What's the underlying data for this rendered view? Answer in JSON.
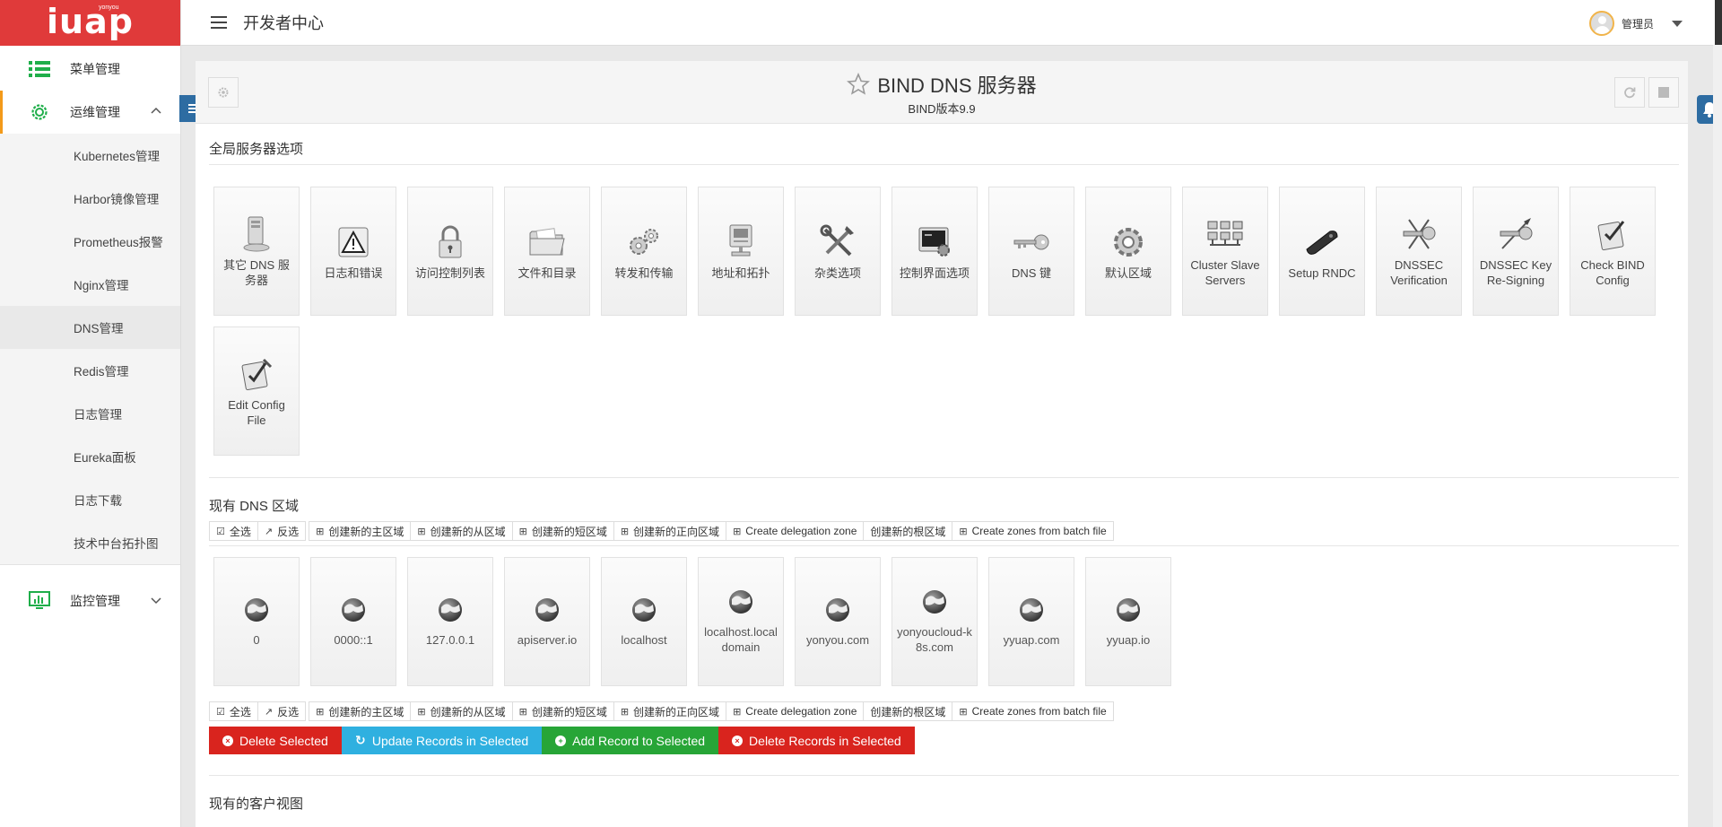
{
  "brand": {
    "logo": "iuap",
    "sub": "yonyou"
  },
  "topbar": {
    "title": "开发者中心",
    "user": "管理员"
  },
  "sidebar": {
    "groups": [
      {
        "label": "菜单管理",
        "icon": "list-icon"
      },
      {
        "label": "运维管理",
        "icon": "gear-icon"
      },
      {
        "label": "监控管理",
        "icon": "monitor-chart-icon"
      }
    ],
    "ops_items": [
      {
        "label": "Kubernetes管理"
      },
      {
        "label": "Harbor镜像管理"
      },
      {
        "label": "Prometheus报警"
      },
      {
        "label": "Nginx管理"
      },
      {
        "label": "DNS管理"
      },
      {
        "label": "Redis管理"
      },
      {
        "label": "日志管理"
      },
      {
        "label": "Eureka面板"
      },
      {
        "label": "日志下载"
      },
      {
        "label": "技术中台拓扑图"
      }
    ]
  },
  "header": {
    "title": "BIND DNS 服务器",
    "subtitle": "BIND版本9.9"
  },
  "global": {
    "title": "全局服务器选项",
    "tiles": [
      {
        "label": "其它 DNS 服务器",
        "icon": "server-icon"
      },
      {
        "label": "日志和错误",
        "icon": "warning-icon"
      },
      {
        "label": "访问控制列表",
        "icon": "lock-icon"
      },
      {
        "label": "文件和目录",
        "icon": "folder-icon"
      },
      {
        "label": "转发和传输",
        "icon": "gears-icon"
      },
      {
        "label": "地址和拓扑",
        "icon": "computer-icon"
      },
      {
        "label": "杂类选项",
        "icon": "tools-icon"
      },
      {
        "label": "控制界面选项",
        "icon": "control-panel-icon"
      },
      {
        "label": "DNS 键",
        "icon": "key-icon"
      },
      {
        "label": "默认区域",
        "icon": "cog-icon"
      },
      {
        "label": "Cluster Slave Servers",
        "icon": "cluster-icon"
      },
      {
        "label": "Setup RNDC",
        "icon": "rndc-icon"
      },
      {
        "label": "DNSSEC Verification",
        "icon": "dnssec-key-icon"
      },
      {
        "label": "DNSSEC Key Re-Signing",
        "icon": "dnssec-resign-icon"
      },
      {
        "label": "Check BIND Config",
        "icon": "checklist-icon"
      },
      {
        "label": "Edit Config File",
        "icon": "edit-checklist-icon"
      }
    ]
  },
  "zones": {
    "title": "现有 DNS 区域",
    "toolbar": [
      {
        "label": "全选",
        "icon": "☑"
      },
      {
        "label": "反选",
        "icon": "↗"
      },
      {
        "label": "创建新的主区域",
        "icon": "⊞"
      },
      {
        "label": "创建新的从区域",
        "icon": "⊞"
      },
      {
        "label": "创建新的短区域",
        "icon": "⊞"
      },
      {
        "label": "创建新的正向区域",
        "icon": "⊞"
      },
      {
        "label": "Create delegation zone",
        "icon": "⊞"
      },
      {
        "label": "创建新的根区域",
        "icon": ""
      },
      {
        "label": "Create zones from batch file",
        "icon": "⊞"
      }
    ],
    "items": [
      {
        "label": "0"
      },
      {
        "label": "0000::1"
      },
      {
        "label": "127.0.0.1"
      },
      {
        "label": "apiserver.io"
      },
      {
        "label": "localhost"
      },
      {
        "label": "localhost.localdomain"
      },
      {
        "label": "yonyou.com"
      },
      {
        "label": "yonyoucloud-k8s.com"
      },
      {
        "label": "yyuap.com"
      },
      {
        "label": "yyuap.io"
      }
    ],
    "actions": [
      {
        "label": "Delete Selected",
        "icon": "×",
        "color": "#d9241e"
      },
      {
        "label": "Update Records in Selected",
        "icon": "↻",
        "color": "#2fb0e0"
      },
      {
        "label": "Add Record to Selected",
        "icon": "+",
        "color": "#27a537"
      },
      {
        "label": "Delete Records in Selected",
        "icon": "×",
        "color": "#d9241e"
      }
    ]
  },
  "views": {
    "title": "现有的客户视图"
  }
}
